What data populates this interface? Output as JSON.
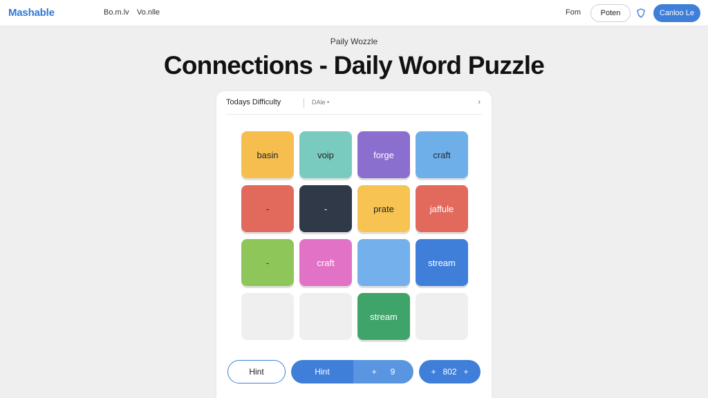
{
  "header": {
    "logo": "Mashable",
    "nav": [
      "Bo.m.lv",
      "Vo.nlle"
    ],
    "fom": "Fom",
    "poten_button": "Poten",
    "cta_button": "Canloo Le"
  },
  "page": {
    "kicker": "Paily Wozzle",
    "title": "Connections - Daily Word Puzzle"
  },
  "card": {
    "difficulty_label": "Todays Difficulty",
    "difficulty_value": "DAle •",
    "chevron": "›"
  },
  "tiles": [
    {
      "word": "basin",
      "color": "#f5be4f",
      "text_color": "#222222"
    },
    {
      "word": "voip",
      "color": "#79cbc0",
      "text_color": "#222222"
    },
    {
      "word": "forge",
      "color": "#8a6fce",
      "text_color": "#ffffff"
    },
    {
      "word": "craft",
      "color": "#6fafe9",
      "text_color": "#1e2a3a"
    },
    {
      "word": "-",
      "color": "#e16a5c",
      "text_color": "#2a1a1a"
    },
    {
      "word": "-",
      "color": "#2f3947",
      "text_color": "#ffffff"
    },
    {
      "word": "prate",
      "color": "#f7c353",
      "text_color": "#222222"
    },
    {
      "word": "jaffule",
      "color": "#e16a5c",
      "text_color": "#ffffff"
    },
    {
      "word": "-",
      "color": "#8fc65a",
      "text_color": "#2a3a1a"
    },
    {
      "word": "craft",
      "color": "#e272c6",
      "text_color": "#ffffff"
    },
    {
      "word": "",
      "color": "#74b0ec",
      "text_color": "#ffffff"
    },
    {
      "word": "stream",
      "color": "#3f7fd9",
      "text_color": "#ffffff"
    },
    {
      "word": "",
      "color": "#efefef",
      "text_color": "#222222"
    },
    {
      "word": "",
      "color": "#efefef",
      "text_color": "#222222"
    },
    {
      "word": "stream",
      "color": "#3fa46a",
      "text_color": "#ffffff"
    },
    {
      "word": "",
      "color": "#efefef",
      "text_color": "#222222"
    }
  ],
  "controls": {
    "hint_outline": "Hint",
    "hint_blue": "Hint",
    "step_plus": "+",
    "step_value": "9",
    "score_plus_left": "+",
    "score_value": "802",
    "score_plus_right": "+"
  }
}
